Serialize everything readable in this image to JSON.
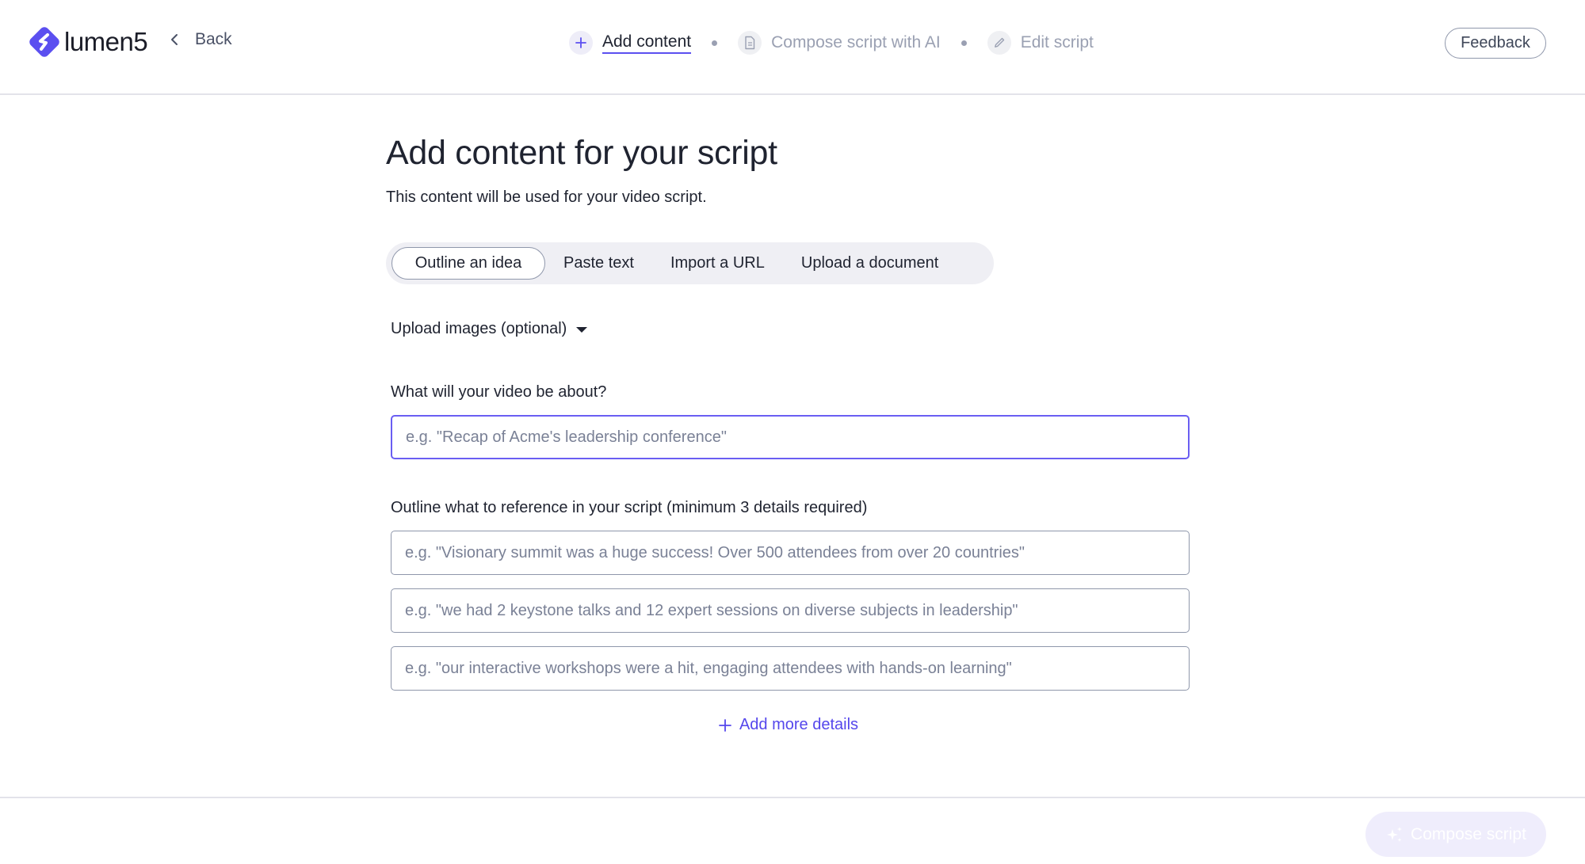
{
  "header": {
    "brand": "lumen5",
    "back_label": "Back",
    "steps": [
      {
        "label": "Add content",
        "icon": "plus-icon",
        "state": "active"
      },
      {
        "label": "Compose script with AI",
        "icon": "document-icon",
        "state": "inactive"
      },
      {
        "label": "Edit script",
        "icon": "pencil-icon",
        "state": "inactive"
      }
    ],
    "feedback_label": "Feedback"
  },
  "main": {
    "title": "Add content for your script",
    "subtitle": "This content will be used for your video script.",
    "tabs": [
      {
        "label": "Outline an idea",
        "selected": true
      },
      {
        "label": "Paste text",
        "selected": false
      },
      {
        "label": "Import a URL",
        "selected": false
      },
      {
        "label": "Upload a document",
        "selected": false
      }
    ],
    "upload_images_label": "Upload images (optional)",
    "about_field": {
      "label": "What will your video be about?",
      "value": "",
      "placeholder": "e.g. \"Recap of Acme's leadership conference\""
    },
    "outline": {
      "label": "Outline what to reference in your script (minimum 3 details required)",
      "details": [
        {
          "value": "",
          "placeholder": "e.g. \"Visionary summit was a huge success! Over 500 attendees from over 20 countries\""
        },
        {
          "value": "",
          "placeholder": "e.g. \"we had 2 keystone talks and 12 expert sessions on diverse subjects in leadership\""
        },
        {
          "value": "",
          "placeholder": "e.g. \"our interactive workshops were a hit, engaging attendees with hands-on learning\""
        }
      ],
      "add_more_label": "Add more details"
    }
  },
  "footer": {
    "compose_label": "Compose script",
    "compose_enabled": false
  },
  "colors": {
    "brand": "#5b4ff0",
    "link": "#5547ec",
    "text": "#1f2330",
    "muted": "#9aa0b2",
    "compose_disabled_bg": "#efedfc"
  }
}
